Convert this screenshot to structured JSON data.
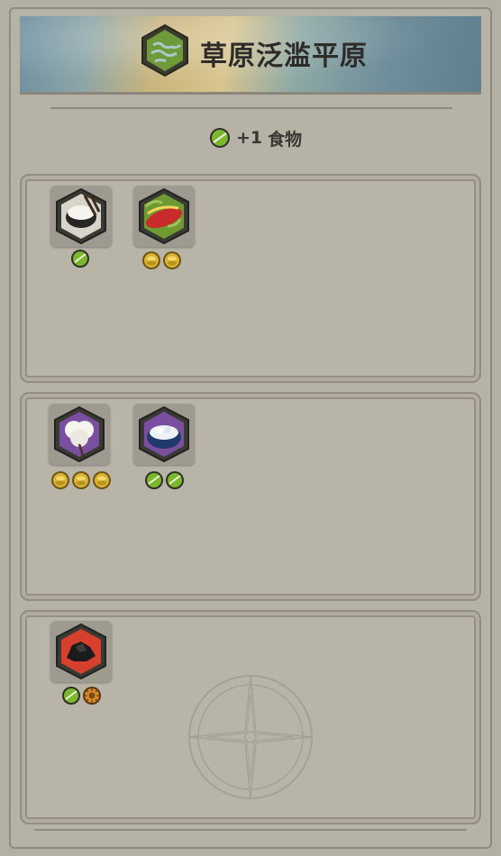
{
  "header": {
    "title": "草原泛滥平原",
    "icon": "grassland-floodplains-icon"
  },
  "yield": {
    "amount": "+1",
    "label": "食物",
    "icon": "food-icon"
  },
  "groups": [
    {
      "resources": [
        {
          "name": "rice-icon",
          "yields": [
            "food"
          ]
        },
        {
          "name": "maize-icon",
          "yields": [
            "gold",
            "gold"
          ]
        }
      ]
    },
    {
      "resources": [
        {
          "name": "cotton-icon",
          "yields": [
            "gold",
            "gold",
            "gold"
          ]
        },
        {
          "name": "sugar-icon",
          "yields": [
            "food",
            "food"
          ]
        }
      ]
    },
    {
      "resources": [
        {
          "name": "coal-icon",
          "yields": [
            "food",
            "production"
          ]
        }
      ]
    }
  ],
  "colors": {
    "food": "#7bb72c",
    "gold": "#d7b233",
    "production": "#d98b2b",
    "panel": "#b7b2a6"
  }
}
